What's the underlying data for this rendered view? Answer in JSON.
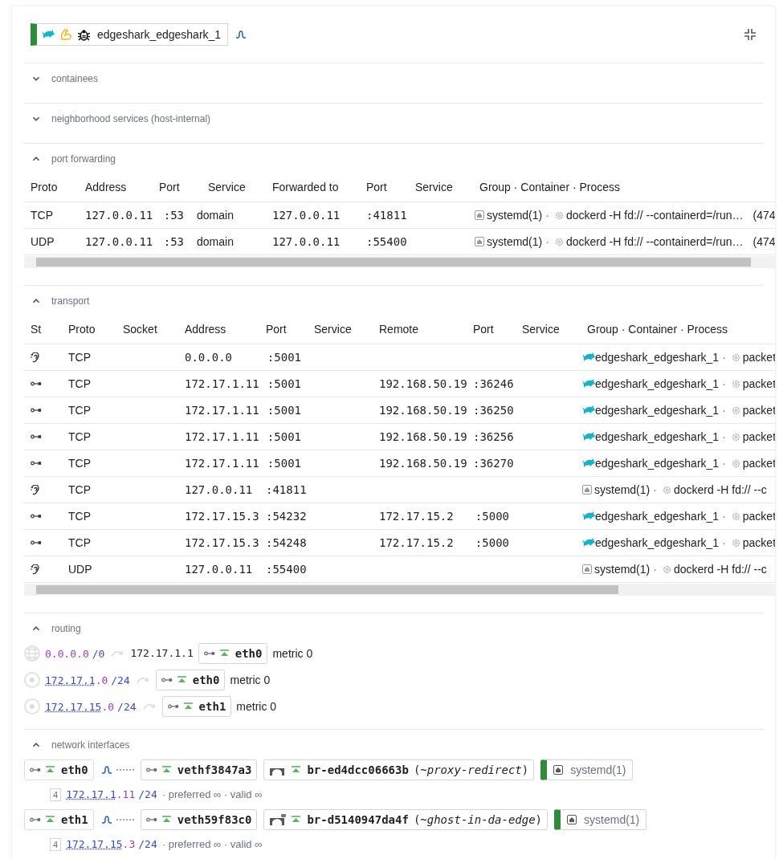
{
  "container": {
    "name": "edgeshark_edgeshark_1"
  },
  "collapsed_sections": [
    {
      "title": "containees",
      "expanded": false
    },
    {
      "title": "neighborhood services (host-internal)",
      "expanded": false
    }
  ],
  "port_forwarding": {
    "title": "port forwarding",
    "expanded": true,
    "columns": [
      "Proto",
      "Address",
      "Port",
      "Service",
      "Forwarded to",
      "Port",
      "Service",
      "Group · Container · Process"
    ],
    "rows": [
      {
        "proto": "TCP",
        "address": "127.0.0.11",
        "port": ":53",
        "service": "domain",
        "forwarded_address": "127.0.0.11",
        "forwarded_port": ":41811",
        "owner": {
          "kind": "systemd",
          "group": "systemd(1)",
          "separator": "·",
          "process": "dockerd -H fd:// --containerd=/run…",
          "pid": "(474"
        }
      },
      {
        "proto": "UDP",
        "address": "127.0.0.11",
        "port": ":53",
        "service": "domain",
        "forwarded_address": "127.0.0.11",
        "forwarded_port": ":55400",
        "owner": {
          "kind": "systemd",
          "group": "systemd(1)",
          "separator": "·",
          "process": "dockerd -H fd:// --containerd=/run…",
          "pid": "(474"
        }
      }
    ]
  },
  "transport": {
    "title": "transport",
    "expanded": true,
    "columns": [
      "St",
      "Proto",
      "Socket",
      "Address",
      "Port",
      "Service",
      "Remote",
      "Port",
      "Service",
      "Group · Container · Process"
    ],
    "rows": [
      {
        "kind": "listen",
        "proto": "TCP",
        "address": "0.0.0.0",
        "port": ":5001",
        "owner": {
          "kind": "container",
          "group": "edgeshark_edgeshark_1",
          "separator": "·",
          "process": "packet"
        }
      },
      {
        "kind": "connected",
        "proto": "TCP",
        "address": "172.17.1.11",
        "port": ":5001",
        "remote": "192.168.50.19",
        "remote_port": ":36246",
        "owner": {
          "kind": "container",
          "group": "edgeshark_edgeshark_1",
          "separator": "·",
          "process": "packet"
        }
      },
      {
        "kind": "connected",
        "proto": "TCP",
        "address": "172.17.1.11",
        "port": ":5001",
        "remote": "192.168.50.19",
        "remote_port": ":36250",
        "owner": {
          "kind": "container",
          "group": "edgeshark_edgeshark_1",
          "separator": "·",
          "process": "packet"
        }
      },
      {
        "kind": "connected",
        "proto": "TCP",
        "address": "172.17.1.11",
        "port": ":5001",
        "remote": "192.168.50.19",
        "remote_port": ":36256",
        "owner": {
          "kind": "container",
          "group": "edgeshark_edgeshark_1",
          "separator": "·",
          "process": "packet"
        }
      },
      {
        "kind": "connected",
        "proto": "TCP",
        "address": "172.17.1.11",
        "port": ":5001",
        "remote": "192.168.50.19",
        "remote_port": ":36270",
        "owner": {
          "kind": "container",
          "group": "edgeshark_edgeshark_1",
          "separator": "·",
          "process": "packet"
        }
      },
      {
        "kind": "listen",
        "proto": "TCP",
        "address": "127.0.0.11",
        "port": ":41811",
        "owner": {
          "kind": "systemd",
          "group": "systemd(1)",
          "separator": "·",
          "process": "dockerd -H fd:// --c"
        }
      },
      {
        "kind": "connected",
        "proto": "TCP",
        "address": "172.17.15.3",
        "port": ":54232",
        "remote": "172.17.15.2",
        "remote_port": ":5000",
        "owner": {
          "kind": "container",
          "group": "edgeshark_edgeshark_1",
          "separator": "·",
          "process": "packet"
        }
      },
      {
        "kind": "connected",
        "proto": "TCP",
        "address": "172.17.15.3",
        "port": ":54248",
        "remote": "172.17.15.2",
        "remote_port": ":5000",
        "owner": {
          "kind": "container",
          "group": "edgeshark_edgeshark_1",
          "separator": "·",
          "process": "packet"
        }
      },
      {
        "kind": "listen",
        "proto": "UDP",
        "address": "127.0.0.11",
        "port": ":55400",
        "owner": {
          "kind": "systemd",
          "group": "systemd(1)",
          "separator": "·",
          "process": "dockerd -H fd:// --c"
        }
      }
    ]
  },
  "routing": {
    "title": "routing",
    "expanded": true,
    "routes": [
      {
        "kind": "default",
        "host": "0.0.0.0",
        "prefix": "/0",
        "gateway": "172.17.1.1",
        "interface": "eth0",
        "metric": "metric 0"
      },
      {
        "kind": "local",
        "network": "172.17.1",
        "host": ".0",
        "prefix": "/24",
        "interface": "eth0",
        "metric": "metric 0"
      },
      {
        "kind": "local",
        "network": "172.17.15",
        "host": ".0",
        "prefix": "/24",
        "interface": "eth1",
        "metric": "metric 0"
      }
    ]
  },
  "network_interfaces": {
    "title": "network interfaces",
    "expanded": true,
    "items": [
      {
        "name": "eth0",
        "peer": "vethf3847a3",
        "bridge": "br-ed4dcc06663b",
        "bridge_alias": "(*~proxy-redirect*)",
        "bridge_locked": false,
        "owner": "systemd(1)",
        "address": {
          "family": "4",
          "network": "172.17.1",
          "host": ".11",
          "prefix": "/24",
          "lifetime": "· preferred ∞ · valid ∞"
        }
      },
      {
        "name": "eth1",
        "peer": "veth59f83c0",
        "bridge": "br-d5140947da4f",
        "bridge_alias": "(*~ghost-in-da-edge*)",
        "bridge_locked": true,
        "owner": "systemd(1)",
        "address": {
          "family": "4",
          "network": "172.17.15",
          "host": ".3",
          "prefix": "/24",
          "lifetime": "· preferred ∞ · valid ∞"
        }
      }
    ]
  }
}
